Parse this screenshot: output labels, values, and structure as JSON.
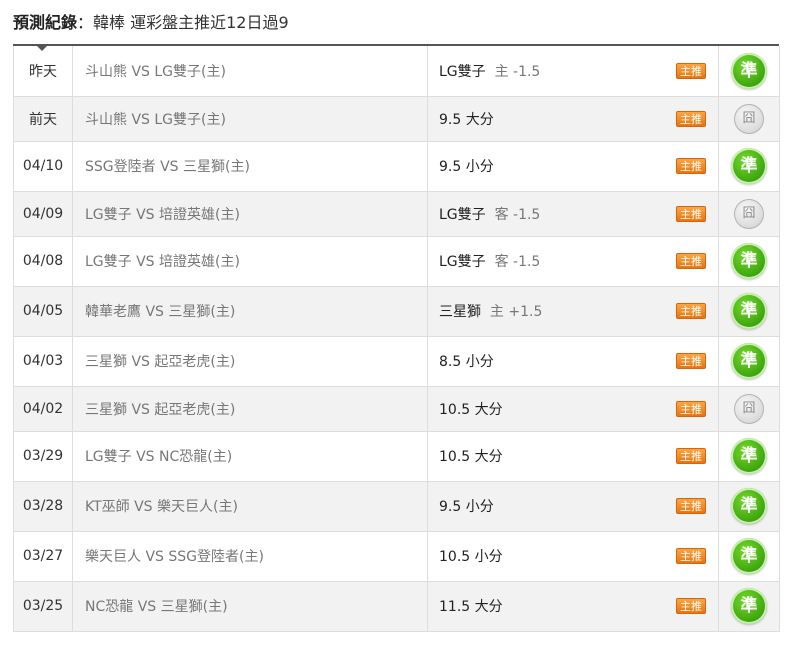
{
  "header": {
    "title": "預測紀錄",
    "separator": "：",
    "description": "韓棒 運彩盤主推近12日過9"
  },
  "badge_label": "主推",
  "rows": [
    {
      "date": "昨天",
      "match": "斗山熊 VS LG雙子(主)",
      "pick": "LG雙子",
      "side": "主 -1.5",
      "result": "準",
      "status": "win"
    },
    {
      "date": "前天",
      "match": "斗山熊 VS LG雙子(主)",
      "pick": "9.5 大分",
      "side": "",
      "result": "囧",
      "status": "lose"
    },
    {
      "date": "04/10",
      "match": "SSG登陸者 VS 三星獅(主)",
      "pick": "9.5 小分",
      "side": "",
      "result": "準",
      "status": "win"
    },
    {
      "date": "04/09",
      "match": "LG雙子 VS 培證英雄(主)",
      "pick": "LG雙子",
      "side": "客 -1.5",
      "result": "囧",
      "status": "lose"
    },
    {
      "date": "04/08",
      "match": "LG雙子 VS 培證英雄(主)",
      "pick": "LG雙子",
      "side": "客 -1.5",
      "result": "準",
      "status": "win"
    },
    {
      "date": "04/05",
      "match": "韓華老鷹 VS 三星獅(主)",
      "pick": "三星獅",
      "side": "主 +1.5",
      "result": "準",
      "status": "win"
    },
    {
      "date": "04/03",
      "match": "三星獅 VS 起亞老虎(主)",
      "pick": "8.5 小分",
      "side": "",
      "result": "準",
      "status": "win"
    },
    {
      "date": "04/02",
      "match": "三星獅 VS 起亞老虎(主)",
      "pick": "10.5 大分",
      "side": "",
      "result": "囧",
      "status": "lose"
    },
    {
      "date": "03/29",
      "match": "LG雙子 VS NC恐龍(主)",
      "pick": "10.5 大分",
      "side": "",
      "result": "準",
      "status": "win"
    },
    {
      "date": "03/28",
      "match": "KT巫師 VS 樂天巨人(主)",
      "pick": "9.5 小分",
      "side": "",
      "result": "準",
      "status": "win"
    },
    {
      "date": "03/27",
      "match": "樂天巨人 VS SSG登陸者(主)",
      "pick": "10.5 小分",
      "side": "",
      "result": "準",
      "status": "win"
    },
    {
      "date": "03/25",
      "match": "NC恐龍 VS 三星獅(主)",
      "pick": "11.5 大分",
      "side": "",
      "result": "準",
      "status": "win"
    }
  ]
}
